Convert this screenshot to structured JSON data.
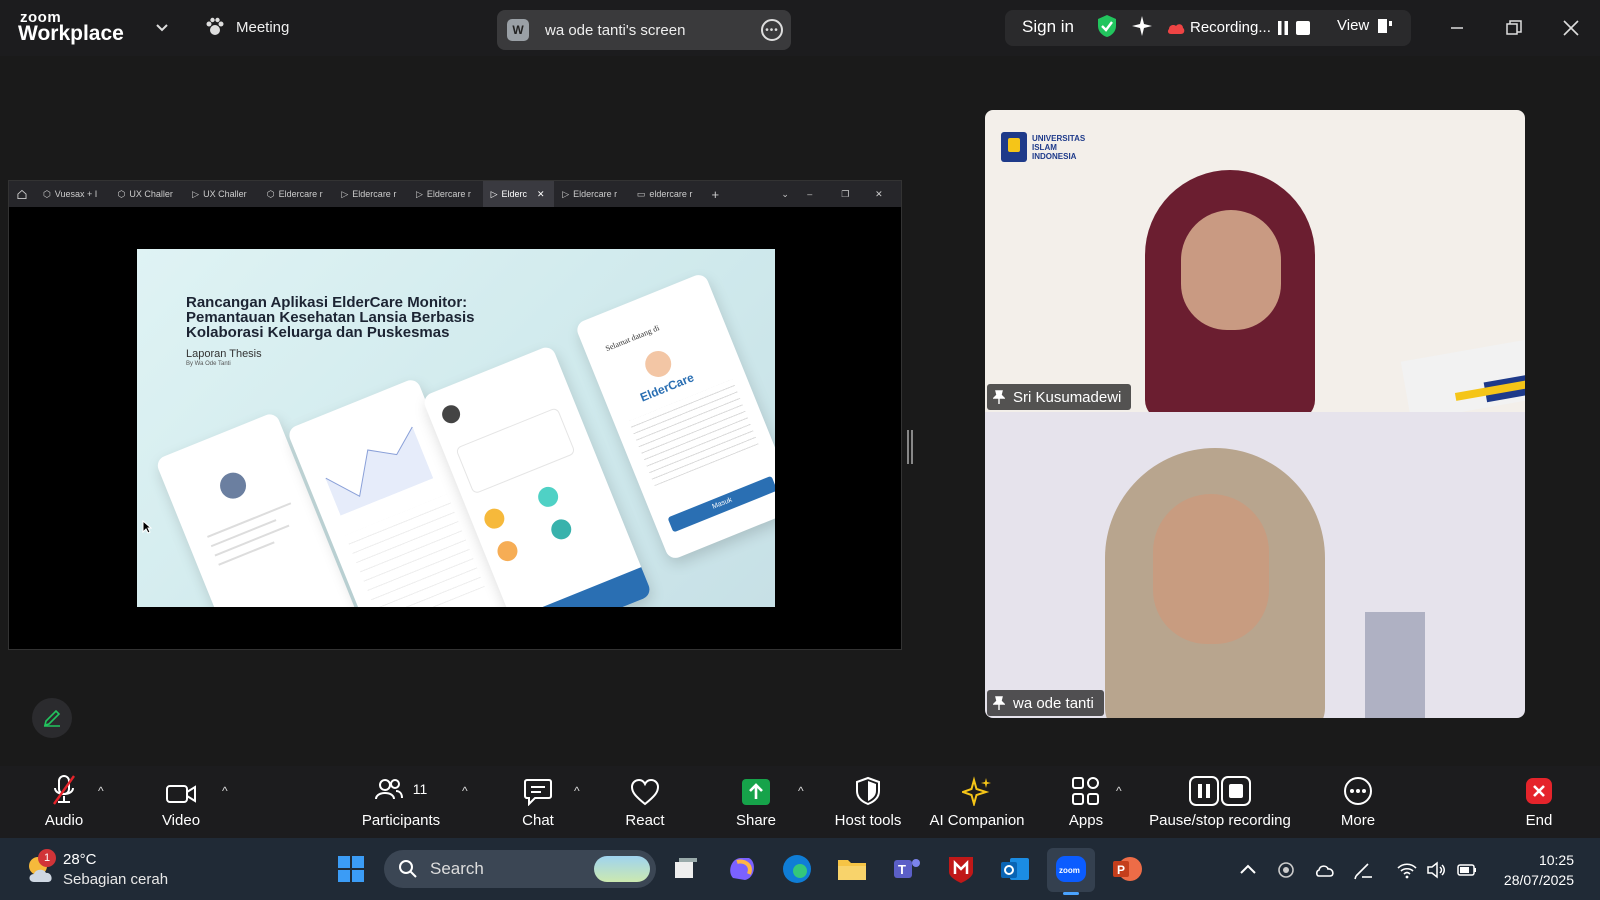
{
  "app": {
    "brand_small": "zoom",
    "brand_big": "Workplace",
    "meeting_label": "Meeting",
    "screen_initial": "W",
    "screen_title": "wa ode tanti's screen",
    "sign_in": "Sign in",
    "recording_label": "Recording...",
    "view_label": "View"
  },
  "browser_tabs": [
    {
      "label": "Vuesax + I",
      "icon": "figma-icon"
    },
    {
      "label": "UX Challer",
      "icon": "figma-icon"
    },
    {
      "label": "UX Challer",
      "icon": "play-icon"
    },
    {
      "label": "Eldercare r",
      "icon": "figma-icon"
    },
    {
      "label": "Eldercare r",
      "icon": "play-icon"
    },
    {
      "label": "Eldercare r",
      "icon": "play-icon"
    },
    {
      "label": "Elderc",
      "icon": "play-icon",
      "active": true
    },
    {
      "label": "Eldercare r",
      "icon": "play-icon"
    },
    {
      "label": "eldercare r",
      "icon": "doc-icon"
    }
  ],
  "slide": {
    "title": "Rancangan Aplikasi ElderCare Monitor: Pemantauan Kesehatan Lansia Berbasis Kolaborasi Keluarga dan Puskesmas",
    "subtitle": "Laporan Thesis",
    "byline": "By Wa Ode Tanti",
    "welcome": "Selamat datang di",
    "brand": "ElderCare",
    "button": "Masuk"
  },
  "participants": [
    {
      "name": "Sri Kusumadewi",
      "org_line1": "UNIVERSITAS",
      "org_line2": "ISLAM",
      "org_line3": "INDONESIA"
    },
    {
      "name": "wa ode tanti"
    }
  ],
  "toolbar": {
    "audio": "Audio",
    "video": "Video",
    "participants": "Participants",
    "participants_count": "11",
    "chat": "Chat",
    "react": "React",
    "share": "Share",
    "host_tools": "Host tools",
    "ai_companion": "AI Companion",
    "apps": "Apps",
    "pause_recording": "Pause/stop recording",
    "more": "More",
    "end": "End"
  },
  "taskbar": {
    "weather_temp": "28°C",
    "weather_desc": "Sebagian cerah",
    "notification_count": "1",
    "search_placeholder": "Search",
    "time": "10:25",
    "date": "28/07/2025"
  },
  "colors": {
    "share_green": "#16a34a",
    "end_red": "#e5242b",
    "recording_red": "#ef4444",
    "shield_green": "#22c55e",
    "ai_gold": "#f5c518",
    "eldercare_blue": "#2a6fb3"
  }
}
